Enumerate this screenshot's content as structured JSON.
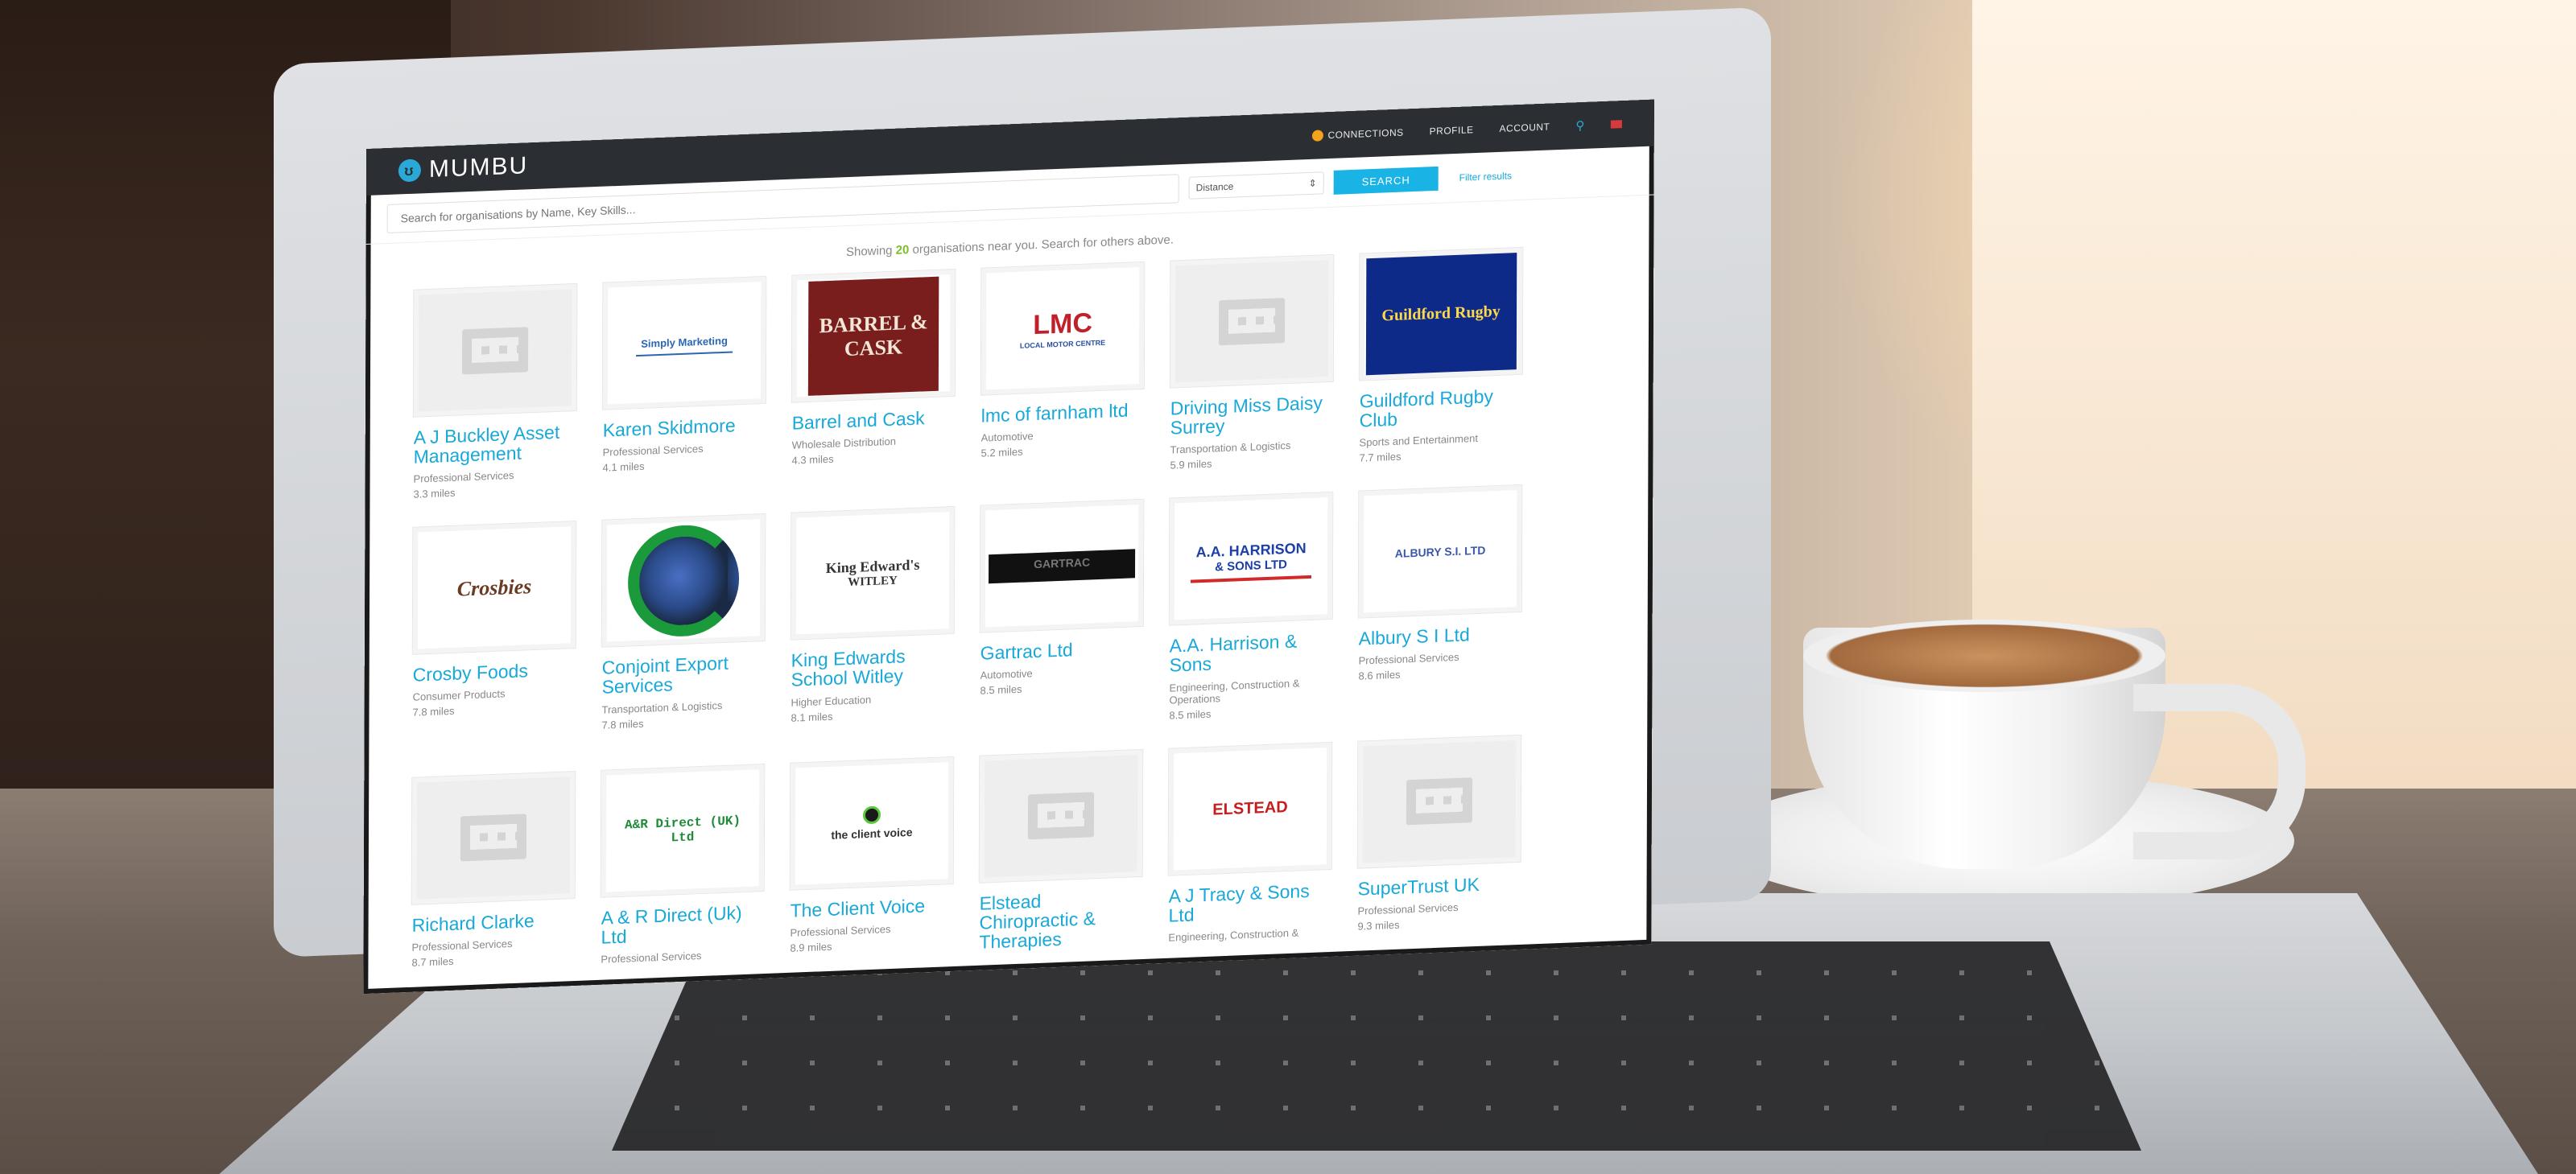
{
  "brand": {
    "name": "MUMBU"
  },
  "nav": [
    {
      "label": "CONNECTIONS",
      "icon": "coin-icon"
    },
    {
      "label": "PROFILE"
    },
    {
      "label": "ACCOUNT"
    }
  ],
  "search": {
    "placeholder": "Search for organisations by Name, Key Skills...",
    "distance_label": "Distance",
    "distance_arrow": "⇕",
    "button_label": "SEARCH",
    "filter_label": "Filter results"
  },
  "summary": {
    "prefix": "Showing",
    "count": "20",
    "suffix": "organisations near you. Search for others above."
  },
  "rows": [
    [
      {
        "name": "A J Buckley Asset Management",
        "sector": "Professional Services",
        "distance": "3.3 miles",
        "logo": "placeholder"
      },
      {
        "name": "Karen Skidmore",
        "sector": "Professional Services",
        "distance": "4.1 miles",
        "logo": "simply",
        "logo_text": "Simply Marketing"
      },
      {
        "name": "Barrel and Cask",
        "sector": "Wholesale Distribution",
        "distance": "4.3 miles",
        "logo": "barrel",
        "logo_text": "BARREL & CASK"
      },
      {
        "name": "lmc of farnham ltd",
        "sector": "Automotive",
        "distance": "5.2 miles",
        "logo": "lmc",
        "logo_text": "LMC",
        "logo_subtext": "LOCAL MOTOR CENTRE"
      },
      {
        "name": "Driving Miss Daisy Surrey",
        "sector": "Transportation & Logistics",
        "distance": "5.9 miles",
        "logo": "placeholder"
      },
      {
        "name": "Guildford Rugby Club",
        "sector": "Sports and Entertainment",
        "distance": "7.7 miles",
        "logo": "guildford",
        "logo_text": "Guildford Rugby"
      }
    ],
    [
      {
        "name": "Crosby Foods",
        "sector": "Consumer Products",
        "distance": "7.8 miles",
        "logo": "crosby",
        "logo_text": "Crosbies"
      },
      {
        "name": "Conjoint Export Services",
        "sector": "Transportation & Logistics",
        "distance": "7.8 miles",
        "logo": "conjoint"
      },
      {
        "name": "King Edwards School Witley",
        "sector": "Higher Education",
        "distance": "8.1 miles",
        "logo": "kinged",
        "logo_text": "King Edward's",
        "logo_subtext": "WITLEY"
      },
      {
        "name": "Gartrac Ltd",
        "sector": "Automotive",
        "distance": "8.5 miles",
        "logo": "gartrac",
        "logo_text": "GARTRAC"
      },
      {
        "name": "A.A. Harrison & Sons",
        "sector": "Engineering, Construction & Operations",
        "distance": "8.5 miles",
        "logo": "harrison",
        "logo_text": "A.A. HARRISON",
        "logo_subtext": "& SONS LTD"
      },
      {
        "name": "Albury S I Ltd",
        "sector": "Professional Services",
        "distance": "8.6 miles",
        "logo": "albury",
        "logo_text": "ALBURY S.I. LTD"
      }
    ],
    [
      {
        "name": "Richard Clarke",
        "sector": "Professional Services",
        "distance": "8.7 miles",
        "logo": "placeholder"
      },
      {
        "name": "A & R Direct (Uk) Ltd",
        "sector": "Professional Services",
        "distance": "",
        "logo": "ar",
        "logo_text": "A&R Direct (UK) Ltd"
      },
      {
        "name": "The Client Voice",
        "sector": "Professional Services",
        "distance": "8.9 miles",
        "logo": "cv",
        "logo_text": "the client voice"
      },
      {
        "name": "Elstead Chiropractic & Therapies",
        "sector": "",
        "distance": "",
        "logo": "placeholder"
      },
      {
        "name": "A J Tracy & Sons Ltd",
        "sector": "Engineering, Construction &",
        "distance": "",
        "logo": "elstead",
        "logo_text": "ELSTEAD"
      },
      {
        "name": "SuperTrust UK",
        "sector": "Professional Services",
        "distance": "9.3 miles",
        "logo": "placeholder"
      }
    ]
  ]
}
